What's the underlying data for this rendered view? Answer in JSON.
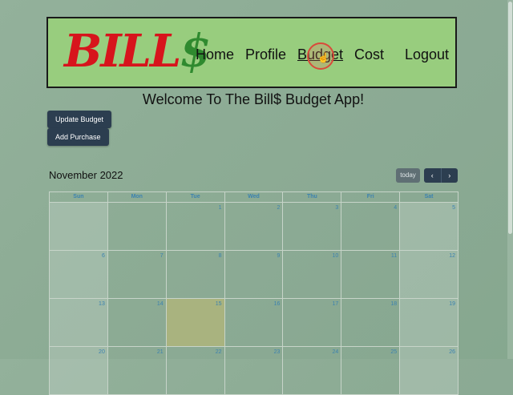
{
  "logo": {
    "part1": "BILL",
    "part2": "$",
    "red": "#d7141c",
    "green": "#2f8a2f"
  },
  "nav": {
    "home": "Home",
    "profile": "Profile",
    "budget": "Budget",
    "cost": "Cost",
    "logout": "Logout",
    "active": "budget"
  },
  "welcome": "Welcome To The Bill$ Budget App!",
  "buttons": {
    "update_budget": "Update Budget",
    "add_purchase": "Add Purchase"
  },
  "calendar": {
    "title": "November 2022",
    "today_label": "today",
    "prev_icon": "chevron-left-icon",
    "next_icon": "chevron-right-icon",
    "prev_glyph": "‹",
    "next_glyph": "›",
    "days": [
      "Sun",
      "Mon",
      "Tue",
      "Wed",
      "Thu",
      "Fri",
      "Sat"
    ],
    "weeks": [
      [
        "",
        "",
        "1",
        "2",
        "3",
        "4",
        "5"
      ],
      [
        "6",
        "7",
        "8",
        "9",
        "10",
        "11",
        "12"
      ],
      [
        "13",
        "14",
        "15",
        "16",
        "17",
        "18",
        "19"
      ],
      [
        "20",
        "21",
        "22",
        "23",
        "24",
        "25",
        "26"
      ]
    ],
    "today": "15",
    "today_color": "#a9b37f"
  }
}
